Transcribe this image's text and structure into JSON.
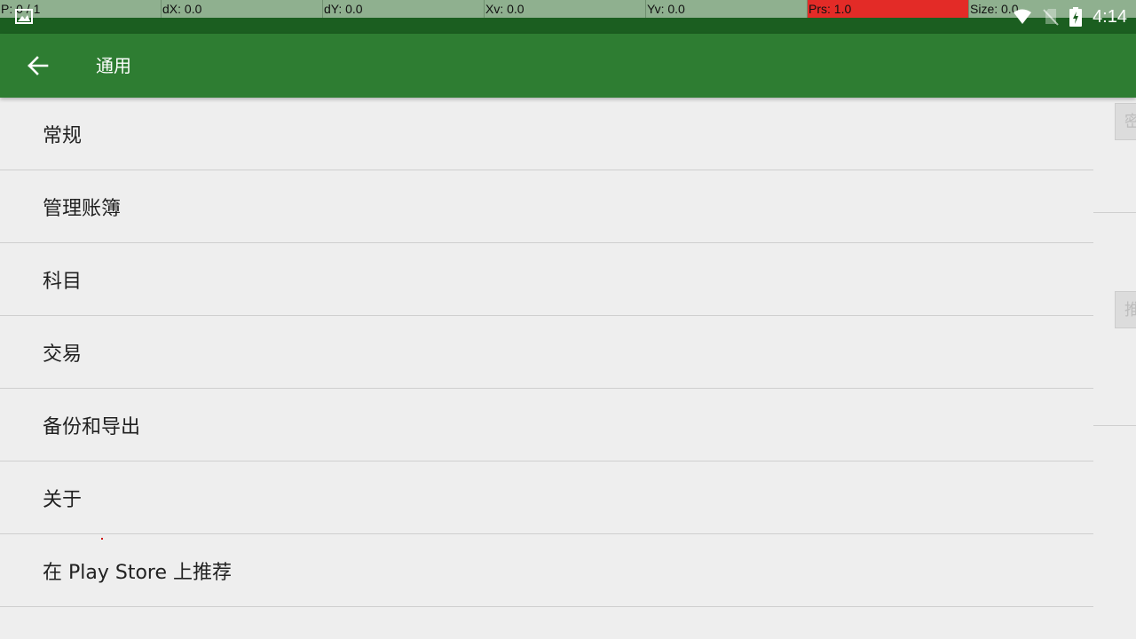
{
  "pointer_location": {
    "cells": [
      "P: 0 / 1",
      "dX: 0.0",
      "dY: 0.0",
      "Xv: 0.0",
      "Yv: 0.0",
      "Prs: 1.0"
    ],
    "size": "Size: 0.0"
  },
  "status_bar": {
    "time": "4:14",
    "icons": [
      "gallery-icon",
      "wifi-icon",
      "no-sim-icon",
      "battery-charging-icon"
    ]
  },
  "app_bar": {
    "title": "通用",
    "back_icon": "arrow-left-icon"
  },
  "settings_list": {
    "items": [
      {
        "label": "常规"
      },
      {
        "label": "管理账簿"
      },
      {
        "label": "科目"
      },
      {
        "label": "交易"
      },
      {
        "label": "备份和导出"
      },
      {
        "label": "关于"
      },
      {
        "label": "在 Play Store 上推荐"
      }
    ]
  },
  "right_pane": {
    "tab1": "密",
    "tab2": "推"
  },
  "colors": {
    "status_bar": "#1b5e20",
    "app_bar": "#2e7d32",
    "background": "#eeeeee",
    "pressure_highlight": "#e32b27"
  }
}
